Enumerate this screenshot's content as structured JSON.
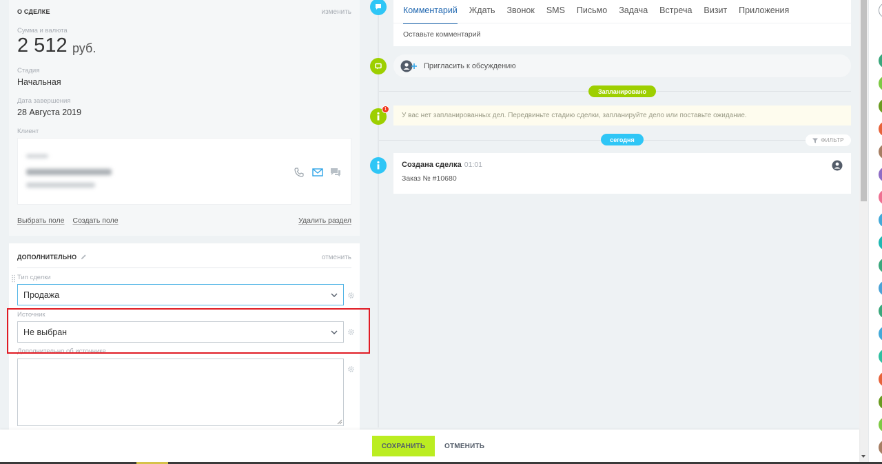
{
  "deal": {
    "title": "О сделке",
    "edit": "изменить",
    "amount_label": "Сумма и валюта",
    "amount_value": "2 512",
    "currency": "руб.",
    "stage_label": "Стадия",
    "stage_value": "Начальная",
    "close_date_label": "Дата завершения",
    "close_date_value": "28 Августа 2019",
    "client_label": "Клиент",
    "links": {
      "select_field": "Выбрать поле",
      "create_field": "Создать поле",
      "delete_section": "Удалить раздел"
    }
  },
  "extra": {
    "title": "Дополнительно",
    "cancel": "отменить",
    "type_label": "Тип сделки",
    "type_value": "Продажа",
    "source_label": "Источник",
    "source_value": "Не выбран",
    "source_info_label": "Дополнительно об источнике"
  },
  "timeline": {
    "tabs": [
      "Комментарий",
      "Ждать",
      "Звонок",
      "SMS",
      "Письмо",
      "Задача",
      "Встреча",
      "Визит",
      "Приложения"
    ],
    "active_tab": "Комментарий",
    "comment_placeholder": "Оставьте комментарий",
    "invite": "Пригласить к обсуждению",
    "planned": "Запланировано",
    "no_planned": "У вас нет запланированных дел. Передвиньте стадию сделки, запланируйте дело или поставьте ожидание.",
    "today": "сегодня",
    "filter": "ФИЛЬТР",
    "notification_count": "1",
    "event": {
      "title": "Создана сделка",
      "time": "01:01",
      "subtitle": "Заказ № #10680"
    }
  },
  "footer": {
    "save": "СОХРАНИТЬ",
    "cancel": "ОТМЕНИТЬ"
  },
  "colors": {
    "accent_blue": "#2fc6f6",
    "accent_green": "#9dcf00",
    "save_button": "#bbed21",
    "highlight": "#e01b24"
  },
  "rail_avatar_colors": [
    "#3aa77c",
    "#7dc943",
    "#6a9a1f",
    "#e8623a",
    "#a67d62",
    "#8e6cc5",
    "#ef6f91",
    "#43a9d8",
    "#1fb8b2",
    "#3aa77c",
    "#4aa2d6",
    "#3aa77c",
    "#43a9d8",
    "#2fbfa0",
    "#e8623a",
    "#6a9a1f",
    "#7dc943",
    "#a67d62"
  ]
}
